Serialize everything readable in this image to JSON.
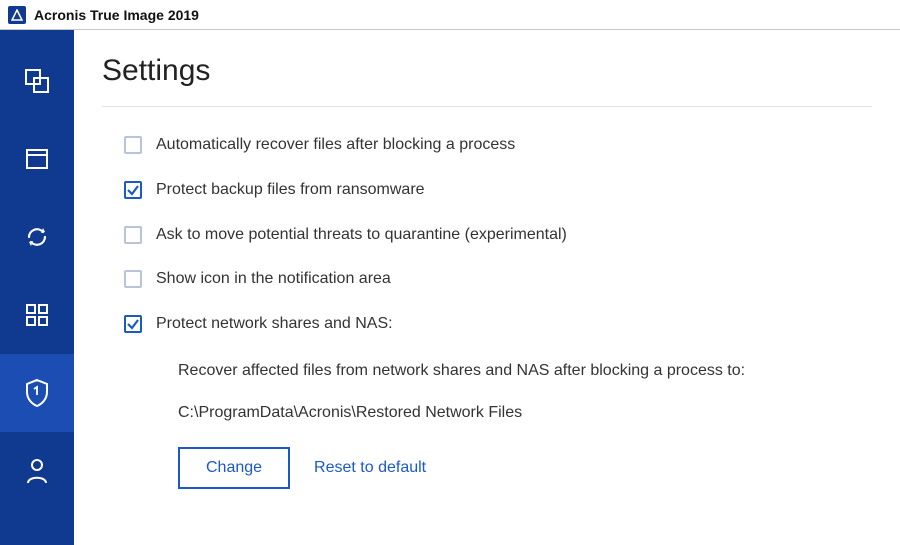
{
  "app": {
    "title": "Acronis True Image 2019"
  },
  "page": {
    "title": "Settings"
  },
  "options": {
    "auto_recover": {
      "label": "Automatically recover files after blocking a process",
      "checked": false
    },
    "protect_backup": {
      "label": "Protect backup files from ransomware",
      "checked": true
    },
    "quarantine": {
      "label": "Ask to move potential threats to quarantine (experimental)",
      "checked": false
    },
    "show_icon": {
      "label": "Show icon in the notification area",
      "checked": false
    },
    "protect_nas": {
      "label": "Protect network shares and NAS:",
      "checked": true
    }
  },
  "nas": {
    "description": "Recover affected files from network shares and NAS after blocking a process to:",
    "path": "C:\\ProgramData\\Acronis\\Restored Network Files",
    "change_label": "Change",
    "reset_label": "Reset to default"
  }
}
